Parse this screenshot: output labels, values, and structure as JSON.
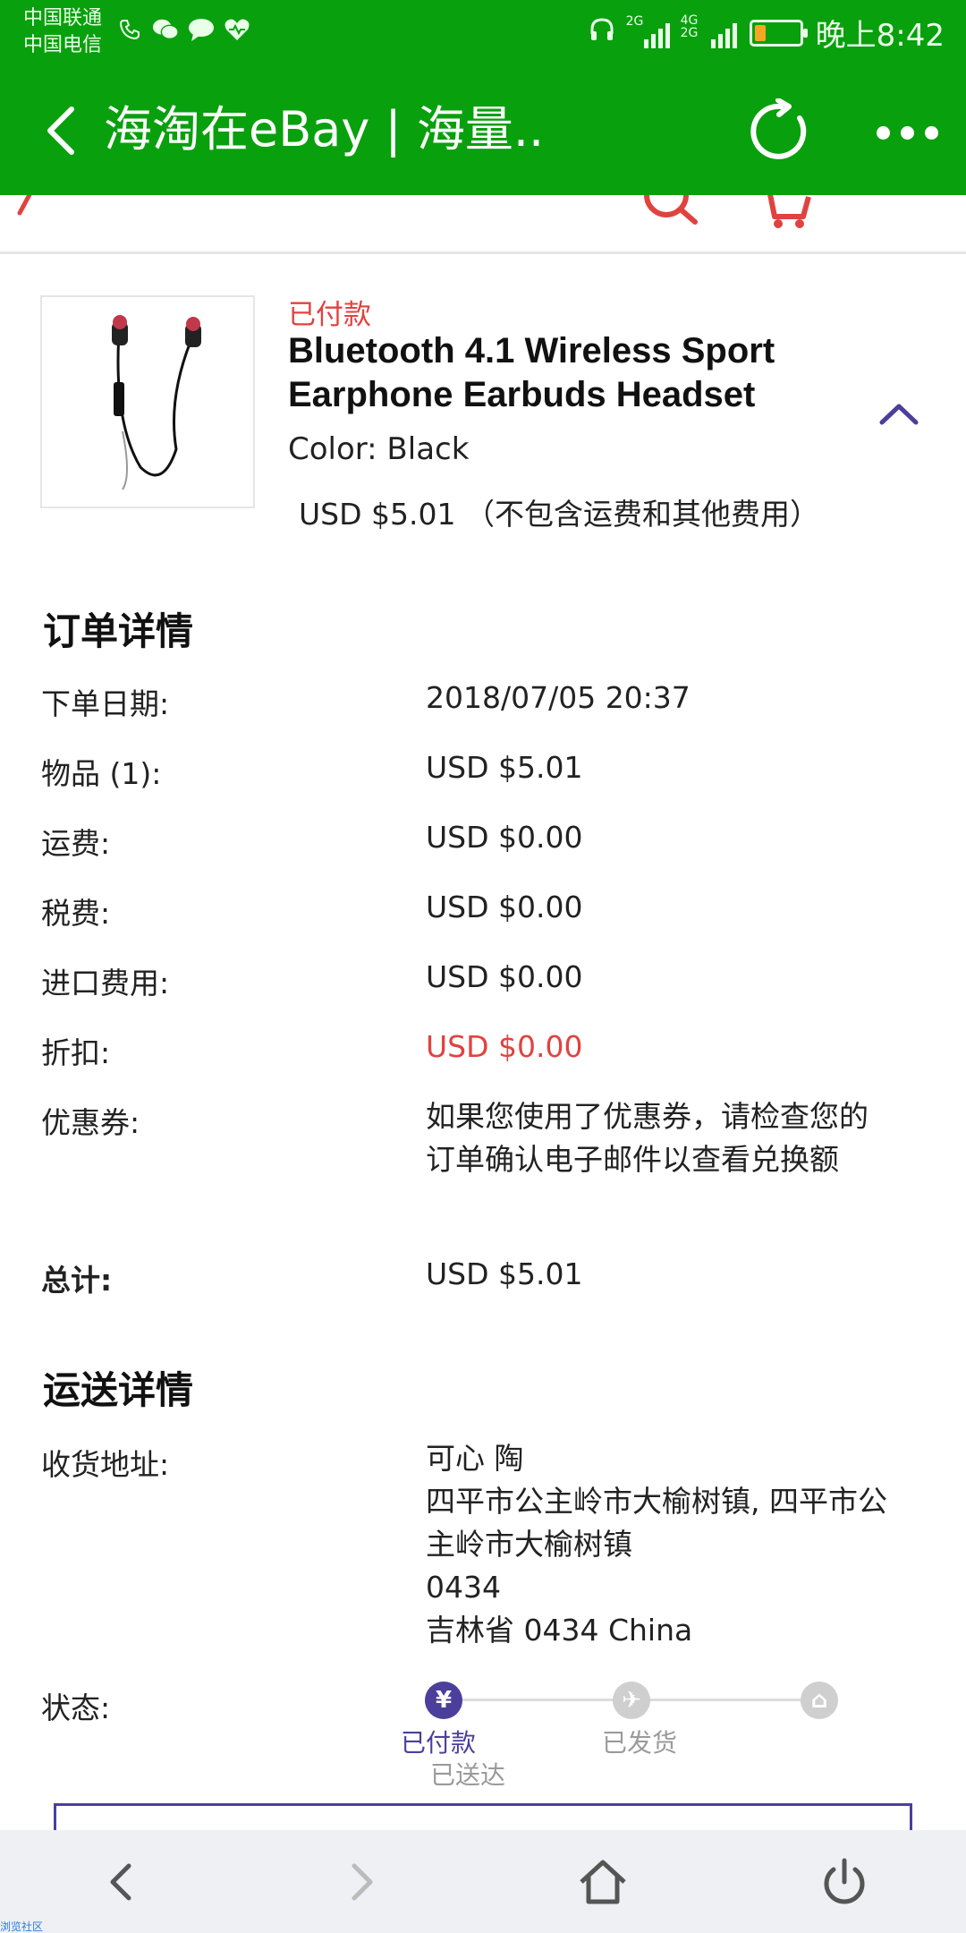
{
  "status_bar": {
    "carrier_1": "中国联通",
    "carrier_2": "中国电信",
    "network_1": "2G",
    "network_2": "4G 2G",
    "time": "晚上8:42",
    "battery_level": 0.25
  },
  "app_bar": {
    "title": "海淘在eBay | 海量.."
  },
  "product": {
    "status": "已付款",
    "title": "Bluetooth 4.1 Wireless Sport Earphone Earbuds Headset",
    "color": "Color: Black",
    "price": "USD $5.01 （不包含运费和其他费用）"
  },
  "order_details": {
    "heading": "订单详情",
    "rows": [
      {
        "label": "下单日期:",
        "value": "2018/07/05 20:37"
      },
      {
        "label": "物品 (1):",
        "value": "USD $5.01"
      },
      {
        "label": "运费:",
        "value": "USD $0.00"
      },
      {
        "label": "税费:",
        "value": "USD $0.00"
      },
      {
        "label": "进口费用:",
        "value": "USD $0.00"
      },
      {
        "label": "折扣:",
        "value": "USD $0.00"
      },
      {
        "label": "优惠券:",
        "value": "如果您使用了优惠券，请检查您的订单确认电子邮件以查看兑换额"
      },
      {
        "label": "总计:",
        "value": "USD $5.01"
      }
    ]
  },
  "shipping_details": {
    "heading": "运送详情",
    "address_label": "收货地址:",
    "address_lines": [
      "可心 陶",
      "四平市公主岭市大榆树镇, 四平市公主岭市大榆树镇",
      "0434",
      "吉林省 0434 China"
    ],
    "status_label": "状态:",
    "steps": [
      {
        "label": "已付款",
        "icon": "yen-icon",
        "symbol": "¥",
        "active": true
      },
      {
        "label": "已发货",
        "icon": "plane-icon",
        "symbol": "✈",
        "active": false
      },
      {
        "label": "已送达",
        "icon": "home-icon",
        "symbol": "⌂",
        "active": false
      }
    ]
  },
  "bottom_nav": {
    "items": [
      "back",
      "forward",
      "home",
      "power"
    ]
  },
  "watermark": "浏览社区",
  "colors": {
    "brand_green": "#09a00d",
    "accent_red": "#e0433f",
    "accent_purple": "#4b3f9c"
  }
}
